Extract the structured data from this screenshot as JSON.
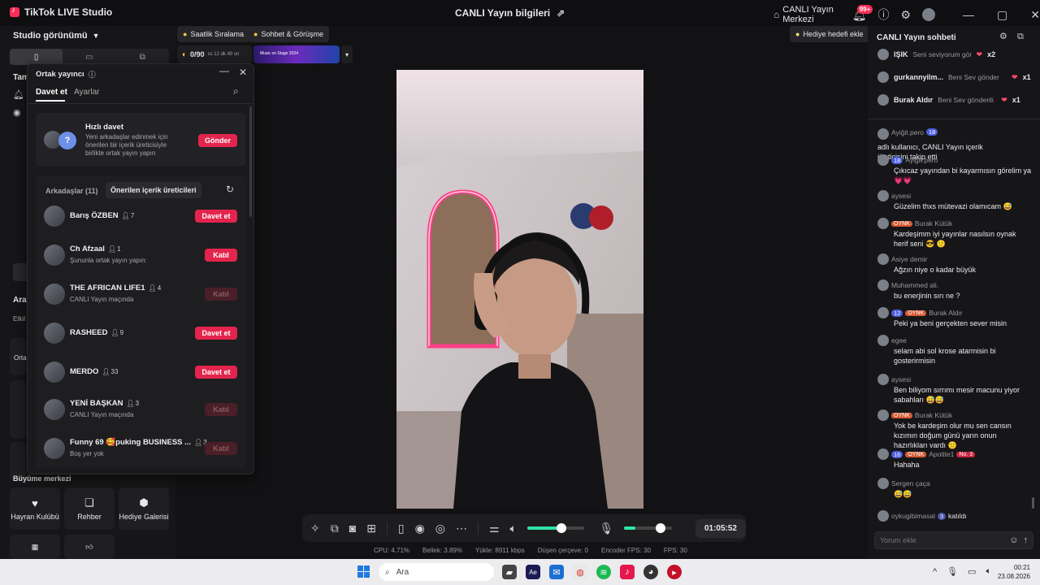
{
  "titlebar": {
    "app_name": "TikTok LIVE Studio",
    "center_title": "CANLI Yayın bilgileri",
    "live_center": "CANLI Yayın Merkezi",
    "notif_badge": "99+"
  },
  "left": {
    "studio_view": "Studio görünümü",
    "section_partial1": "Tam",
    "section_partial2": "Ara",
    "etkin_partial": "Etkil",
    "orta_partial": "Orta",
    "growth_center": "Büyüme merkezi",
    "tiles": [
      {
        "icon": "heart-icon",
        "label": "Hayran Kulübü"
      },
      {
        "icon": "guide-icon",
        "label": "Rehber"
      },
      {
        "icon": "gift-gallery-icon",
        "label": "Hediye Galerisi"
      }
    ]
  },
  "top": {
    "ranking": "Saatlik Sıralama",
    "chat_meeting": "Sohbet & Görüşme",
    "goal_count": "0/90",
    "goal_time": "ss 12 dk 40 sn",
    "banner_text": "Music on Stage 2024",
    "gift_goal": "Hediye hedefi ekle"
  },
  "modal": {
    "title": "Ortak yayıncı",
    "tabs": [
      "Davet et",
      "Ayarlar"
    ],
    "quick": {
      "title": "Hızlı davet",
      "desc": "Yeni arkadaşlar edinmek için önerilen bir içerik üreticisiyle birlikte ortak yayın yapın",
      "button": "Gönder"
    },
    "friends_tab": "Arkadaşlar (11)",
    "suggested_tab": "Önerilen içerik üreticileri",
    "users": [
      {
        "name": "Barış ÖZBEN",
        "count": "7",
        "sub": "",
        "button": "Davet et",
        "dim": false
      },
      {
        "name": "Ch Afzaal",
        "count": "1",
        "sub": "Şununla ortak yayın yapın:",
        "button": "Katıl",
        "dim": false
      },
      {
        "name": "THE AFRICAN LIFE1",
        "count": "4",
        "sub": "CANLI Yayın maçında",
        "button": "Katıl",
        "dim": true
      },
      {
        "name": "RASHEED",
        "count": "9",
        "sub": "",
        "button": "Davet et",
        "dim": false
      },
      {
        "name": "MERDO",
        "count": "33",
        "sub": "",
        "button": "Davet et",
        "dim": false
      },
      {
        "name": "YENİ BAŞKAN",
        "count": "3",
        "sub": "CANLI Yayın maçında",
        "button": "Katıl",
        "dim": true
      },
      {
        "name": "Funny 69 🥰puking BUSINESS ...",
        "count": "3",
        "sub": "Boş yer yok",
        "button": "Katıl",
        "dim": true
      }
    ]
  },
  "toolbar": {
    "timer": "01:05:52",
    "volume_level": 0.56,
    "mic_level": 0.7
  },
  "stats": {
    "cpu": "CPU: 4.71%",
    "memory": "Bellek: 3.89%",
    "upload": "Yükle: 8911 kbps",
    "dropped": "Düşen çerçeve: 0",
    "encoder_fps": "Encoder FPS: 30",
    "fps": "FPS: 30"
  },
  "chat": {
    "title": "CANLI Yayın sohbeti",
    "gifts": [
      {
        "name": "IŞIK",
        "text": "Seni seviyorum gönde",
        "mult": "x2"
      },
      {
        "name": "gurkannyilm...",
        "text": "Beni Sev gönder",
        "mult": "x1"
      },
      {
        "name": "Burak Aldır",
        "text": "Beni Sev gönderili",
        "mult": "x1"
      }
    ],
    "messages": [
      {
        "user": "Ayiğit.pero",
        "lvl": "18",
        "tag": "",
        "text": "adlı kullanıcı, CANLI Yayın içerik üreticisini takip etti",
        "inline": true
      },
      {
        "user": "Ayiğit.pero",
        "lvl": "18",
        "tag": "",
        "text": "Çıkıcaz yayından bi kayarmısın görelim ya 💗💗"
      },
      {
        "user": "aysesi",
        "lvl": "",
        "tag": "",
        "text": "Güzelim thxs mütevazi olamıcam 😅"
      },
      {
        "user": "Burak Kütük",
        "lvl": "",
        "tag": "OYNK",
        "text": "Kardeşimm iyi yayınlar nasılsın oynak herif seni 😎 🙂"
      },
      {
        "user": "Asiye demir",
        "lvl": "",
        "tag": "",
        "text": "Ağzın niye o kadar büyük"
      },
      {
        "user": "Muhammed ali.",
        "lvl": "",
        "tag": "",
        "text": "bu enerjinin sırı ne ?"
      },
      {
        "user": "Burak Aldır",
        "lvl": "12",
        "tag": "OYNK",
        "text": "Peki ya beni gerçekten sever misin"
      },
      {
        "user": "egee",
        "lvl": "",
        "tag": "",
        "text": "selam abi sol krose atarmisin bi gosterirmisin"
      },
      {
        "user": "aysesi",
        "lvl": "",
        "tag": "",
        "text": "Ben biliyom sırrımı mesir macunu yiyor sabahları 😅😅"
      },
      {
        "user": "Burak Kütük",
        "lvl": "",
        "tag": "OYNK",
        "text": "Yok be kardeşim olur mu sen cansın kızımın doğum günü yarın onun hazırlıkları vardı 🙂"
      },
      {
        "user": "Apotite1",
        "lvl": "16",
        "tag": "OYNK",
        "text": "Hahaha",
        "rank": "No. 3"
      },
      {
        "user": "Sergen çaça",
        "lvl": "",
        "tag": "",
        "text": "😅😅"
      }
    ],
    "joined": {
      "user": "oykugibimasal",
      "lvl": "3",
      "text": "katıldı"
    },
    "input_placeholder": "Yorum ekle"
  },
  "taskbar": {
    "search": "Ara",
    "time": "00:21",
    "date": "23.08.2026"
  }
}
